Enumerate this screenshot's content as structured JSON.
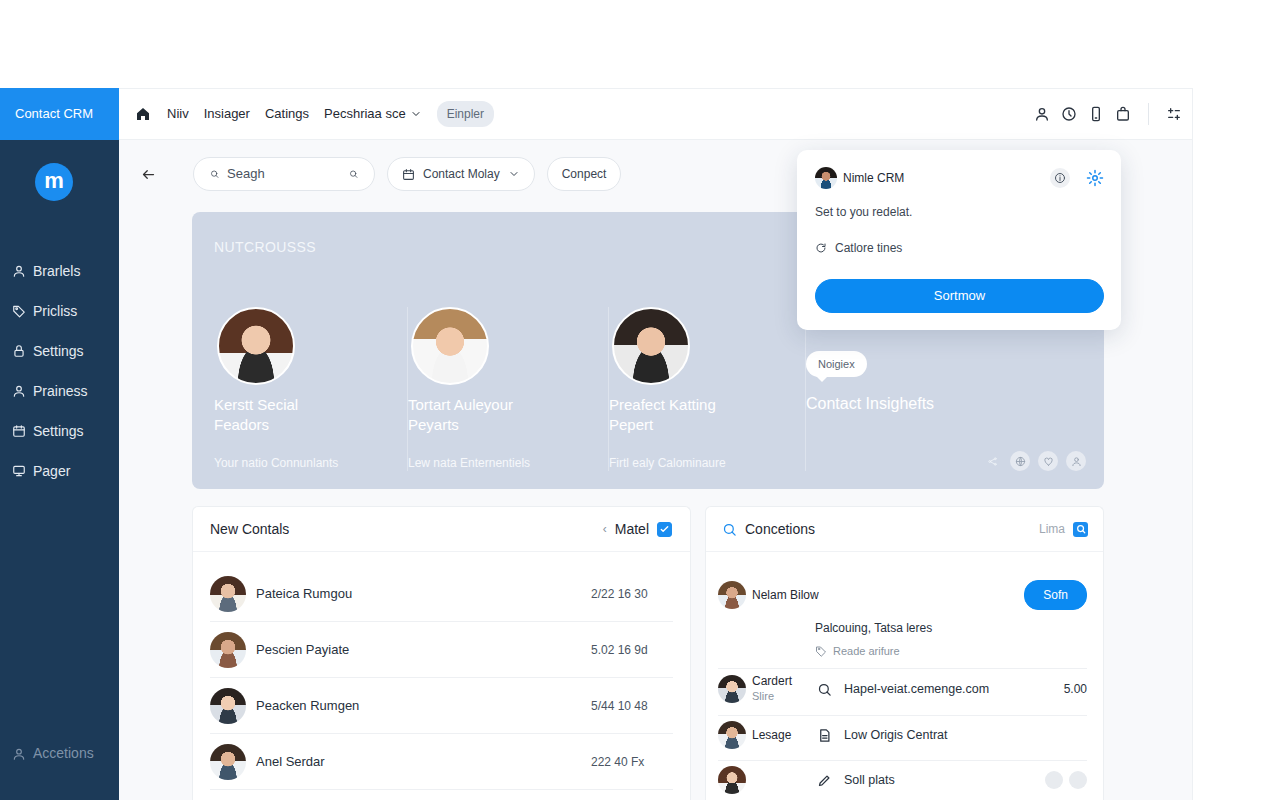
{
  "app": {
    "title": "Contact CRM",
    "logo": "m"
  },
  "sidebar": {
    "items": [
      {
        "label": "Brarlels",
        "selected": false
      },
      {
        "label": "Pricliss",
        "selected": false
      },
      {
        "label": "Settings",
        "selected": false
      },
      {
        "label": "Prainess",
        "selected": false
      },
      {
        "label": "Settings",
        "selected": false
      },
      {
        "label": "Pager",
        "selected": false
      }
    ],
    "footer": "Accetions"
  },
  "topnav": {
    "items": [
      {
        "label": "Niiv",
        "kind": "link"
      },
      {
        "label": "Insiager",
        "kind": "link"
      },
      {
        "label": "Catings",
        "kind": "link"
      },
      {
        "label": "Pecshriaa sce",
        "kind": "dropdown"
      }
    ],
    "chip": "Einpler"
  },
  "toolbar": {
    "search": {
      "placeholder": "Seagh"
    },
    "filter": "Contact Molay",
    "button": "Conpect"
  },
  "hero": {
    "title": "NUTCROUSSS",
    "cards": [
      {
        "title": "Kerstt Secial Feadors",
        "subtitle": "Your natio Connunlants"
      },
      {
        "title": "Tortart Auleyour Peyarts",
        "subtitle": "Lew nata Enternentiels"
      },
      {
        "title": "Preafect Katting Pepert",
        "subtitle": "Firtl ealy Calominaure"
      }
    ],
    "insight": {
      "bubble": "Noigiex",
      "title": "Contact Insighefts"
    }
  },
  "popup": {
    "title": "Nimle CRM",
    "message": "Set to you redelat.",
    "option": "Catlore tines",
    "button": "Sortmow"
  },
  "new_contacts": {
    "title": "New Contals",
    "back": "‹",
    "filter": "Matel",
    "checked": true,
    "rows": [
      {
        "name": "Pateica Rumgou",
        "time": "2/22 16 30"
      },
      {
        "name": "Pescien Payiate",
        "time": "5.02 16 9d"
      },
      {
        "name": "Peacken Rumgen",
        "time": "5/44 10 48"
      },
      {
        "name": "Anel Serdar",
        "time": "222 40 Fx"
      }
    ]
  },
  "connections": {
    "title": "Concetions",
    "filter": "Lima",
    "rows": [
      {
        "kind": "action",
        "name": "Nelam Bilow",
        "button": "Sofn",
        "detail": "Palcouing, Tatsa leres",
        "note": "Reade arifure"
      },
      {
        "kind": "link",
        "name": "Cardert",
        "subname": "Slire",
        "text": "Hapel-veiat.cemenge.com",
        "value": "5.00"
      },
      {
        "kind": "doc",
        "name": "Lesage",
        "text": "Low Origis Centrat"
      },
      {
        "kind": "plain",
        "text": "Soll plats"
      }
    ]
  }
}
